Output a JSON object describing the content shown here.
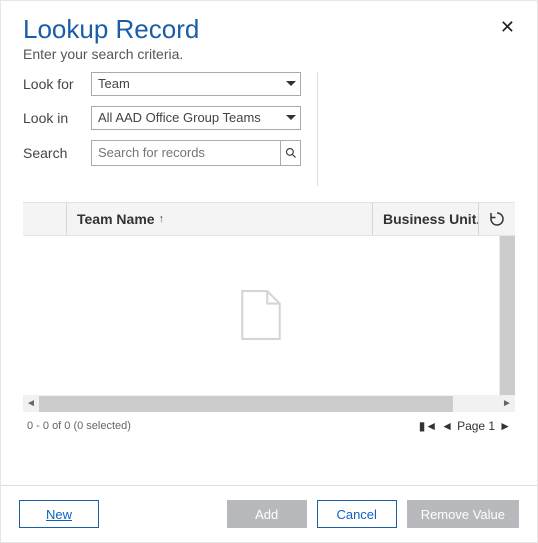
{
  "header": {
    "title": "Lookup Record",
    "subtitle": "Enter your search criteria."
  },
  "criteria": {
    "look_for_label": "Look for",
    "look_for_value": "Team",
    "look_in_label": "Look in",
    "look_in_value": "All AAD Office Group Teams",
    "search_label": "Search",
    "search_placeholder": "Search for records"
  },
  "grid": {
    "columns": {
      "team_name": "Team Name",
      "business_unit": "Business Unit..."
    },
    "sort_indicator": "↑"
  },
  "pager": {
    "status": "0 - 0 of 0 (0 selected)",
    "page_label": "Page 1"
  },
  "footer": {
    "new": "New",
    "add": "Add",
    "cancel": "Cancel",
    "remove": "Remove Value"
  }
}
